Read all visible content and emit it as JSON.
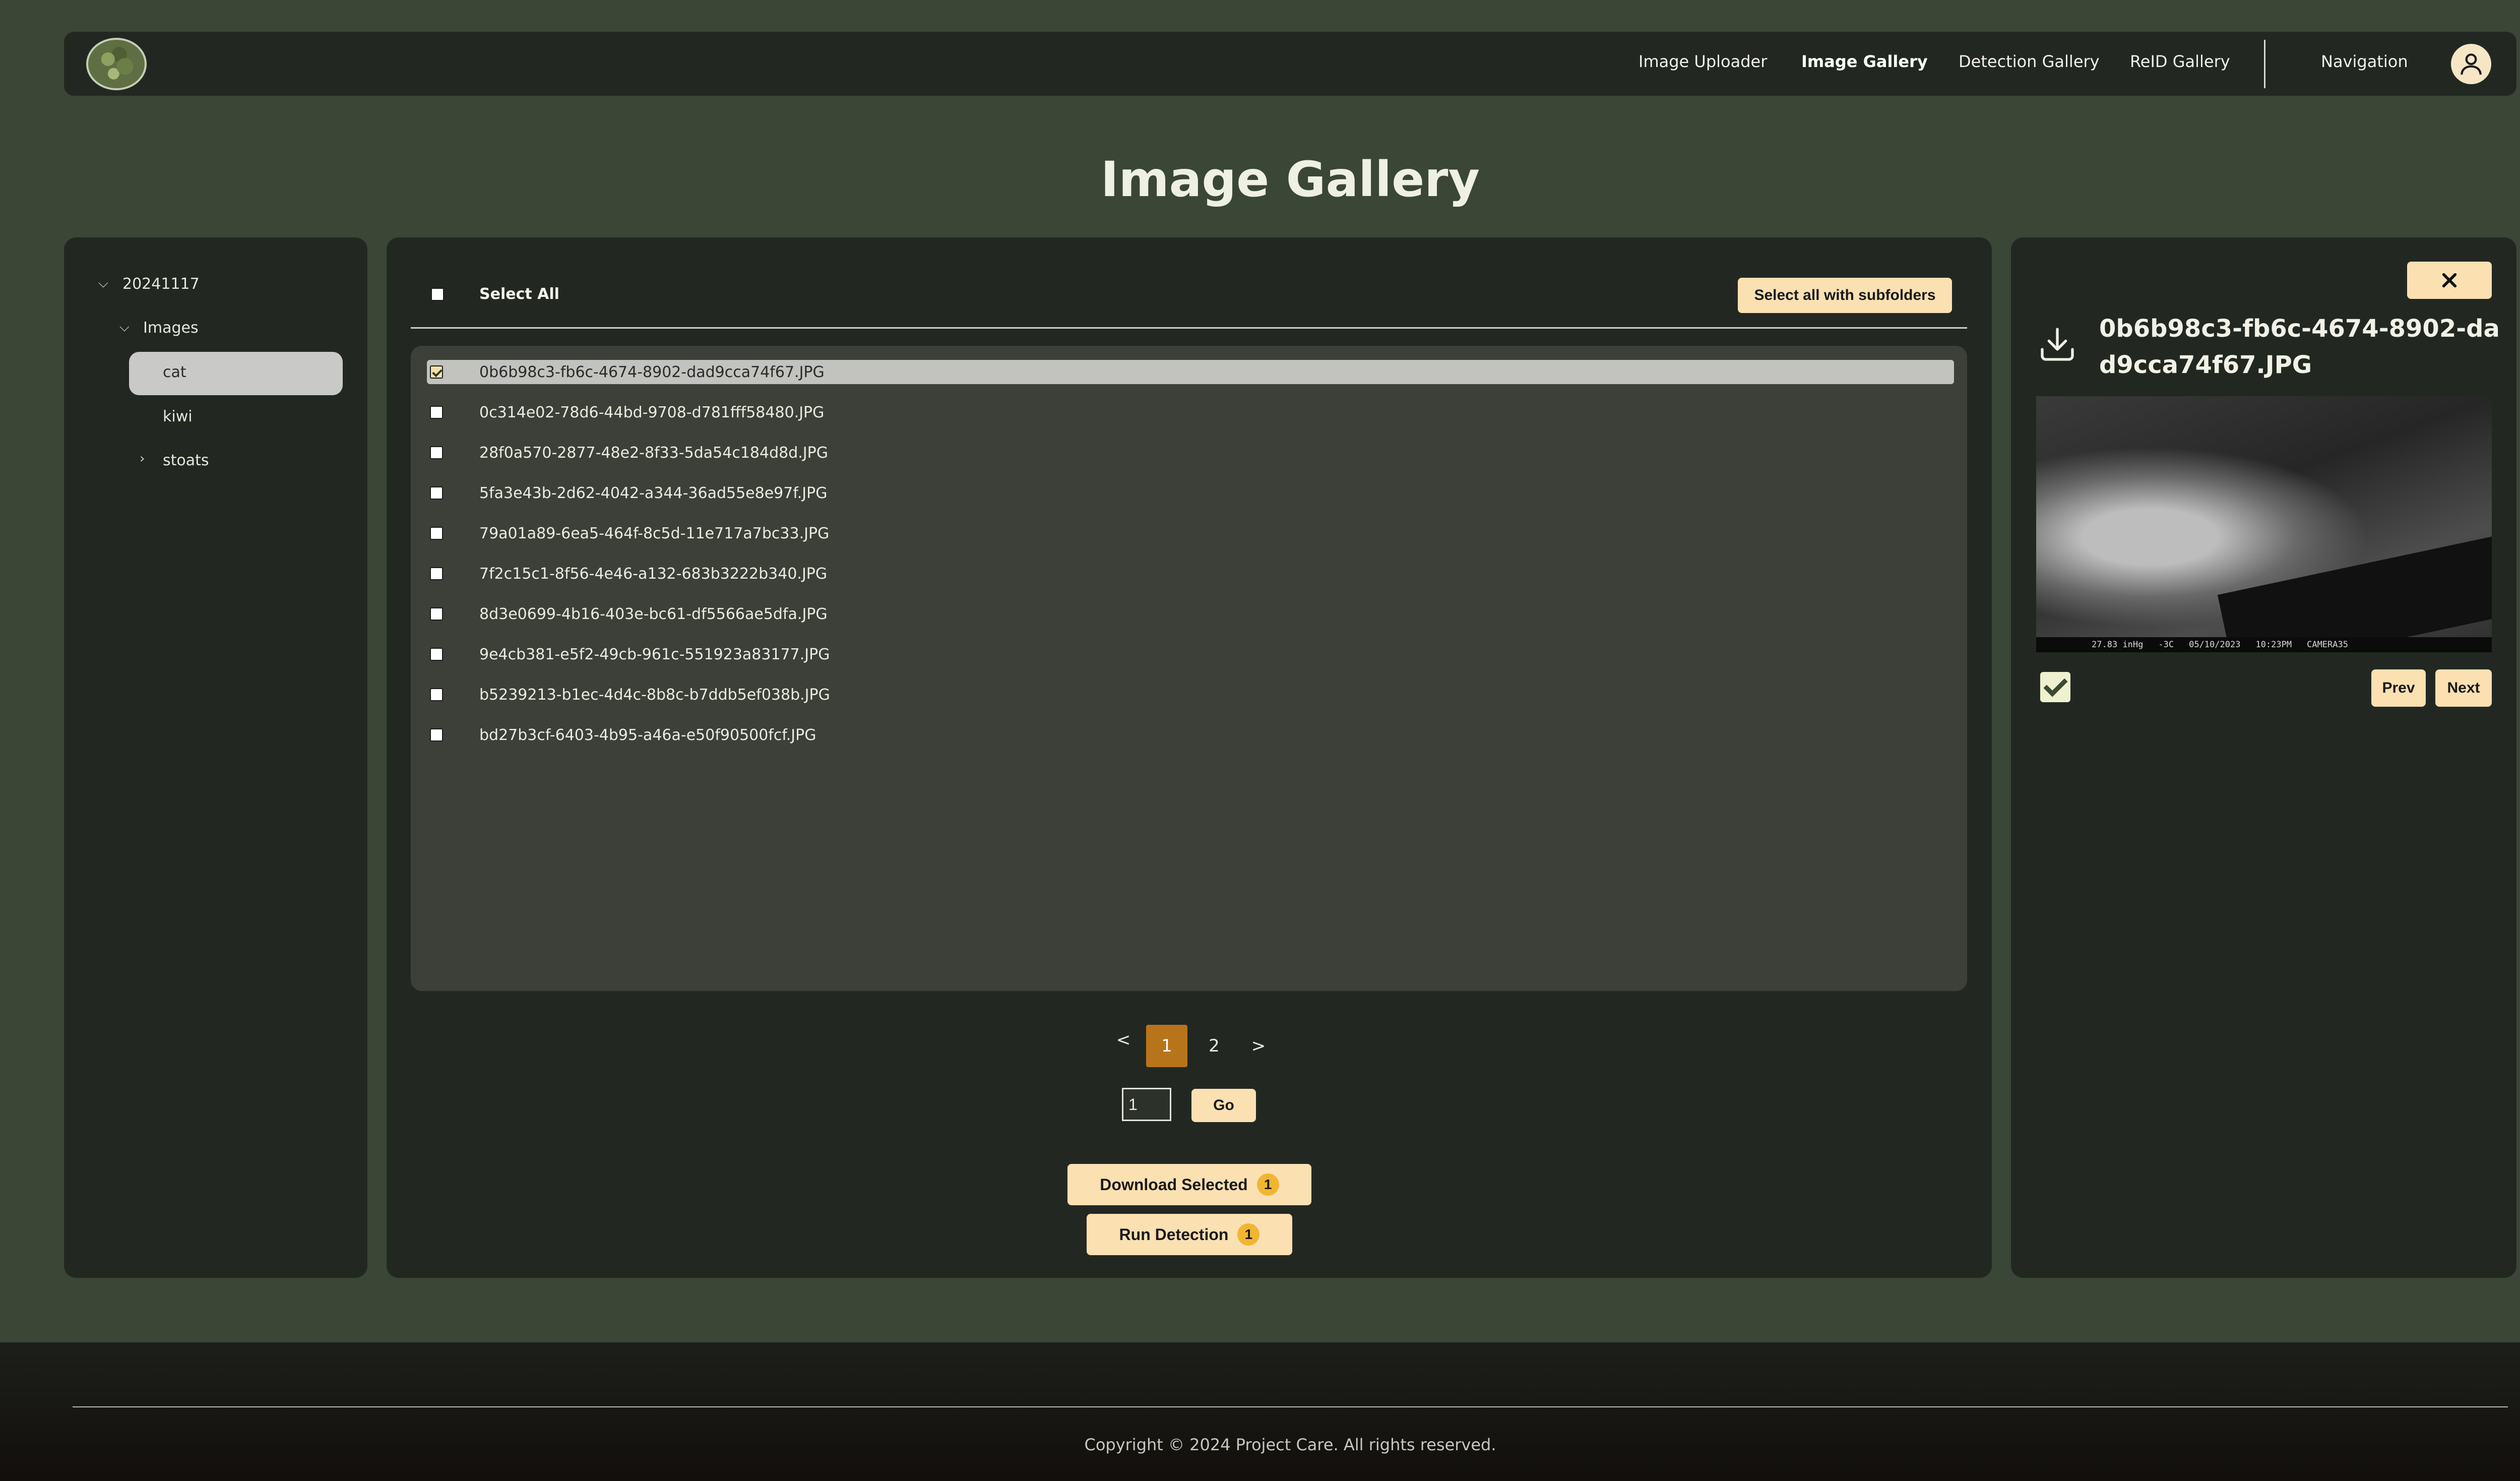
{
  "header": {
    "logo": "project-care-logo",
    "nav": [
      "Image Uploader",
      "Image Gallery",
      "Detection Gallery",
      "ReID Gallery",
      "Navigation"
    ],
    "active": "Image Gallery",
    "user_icon": "user-icon"
  },
  "page_title": "Image Gallery",
  "sidebar": {
    "root": "20241117",
    "folder": "Images",
    "items": [
      "cat",
      "kiwi",
      "stoats"
    ],
    "selected": "cat"
  },
  "gallery": {
    "select_all_label": "Select All",
    "select_subfolders_label": "Select all with subfolders",
    "files": [
      {
        "name": "0b6b98c3-fb6c-4674-8902-dad9cca74f67.JPG",
        "checked": true
      },
      {
        "name": "0c314e02-78d6-44bd-9708-d781fff58480.JPG",
        "checked": false
      },
      {
        "name": "28f0a570-2877-48e2-8f33-5da54c184d8d.JPG",
        "checked": false
      },
      {
        "name": "5fa3e43b-2d62-4042-a344-36ad55e8e97f.JPG",
        "checked": false
      },
      {
        "name": "79a01a89-6ea5-464f-8c5d-11e717a7bc33.JPG",
        "checked": false
      },
      {
        "name": "7f2c15c1-8f56-4e46-a132-683b3222b340.JPG",
        "checked": false
      },
      {
        "name": "8d3e0699-4b16-403e-bc61-df5566ae5dfa.JPG",
        "checked": false
      },
      {
        "name": "9e4cb381-e5f2-49cb-961c-551923a83177.JPG",
        "checked": false
      },
      {
        "name": "b5239213-b1ec-4d4c-8b8c-b7ddb5ef038b.JPG",
        "checked": false
      },
      {
        "name": "bd27b3cf-6403-4b95-a46a-e50f90500fcf.JPG",
        "checked": false
      }
    ]
  },
  "pagination": {
    "prev": "<",
    "pages": [
      "1",
      "2"
    ],
    "current": "1",
    "next": ">",
    "input_value": "1",
    "go_label": "Go"
  },
  "actions": {
    "download_label": "Download Selected",
    "download_count": "1",
    "detect_label": "Run Detection",
    "detect_count": "1"
  },
  "preview": {
    "close_icon": "close-icon",
    "download_icon": "download-icon",
    "filename": "0b6b98c3-fb6c-4674-8902-dad9cca74f67.JPG",
    "checked": true,
    "prev_label": "Prev",
    "next_label": "Next",
    "camera_strip": [
      "27.83 inHg",
      "-3C",
      "05/10/2023",
      "10:23PM",
      "CAMERA35"
    ]
  },
  "footer": {
    "copyright": "Copyright © 2024 Project Care. All rights reserved."
  }
}
